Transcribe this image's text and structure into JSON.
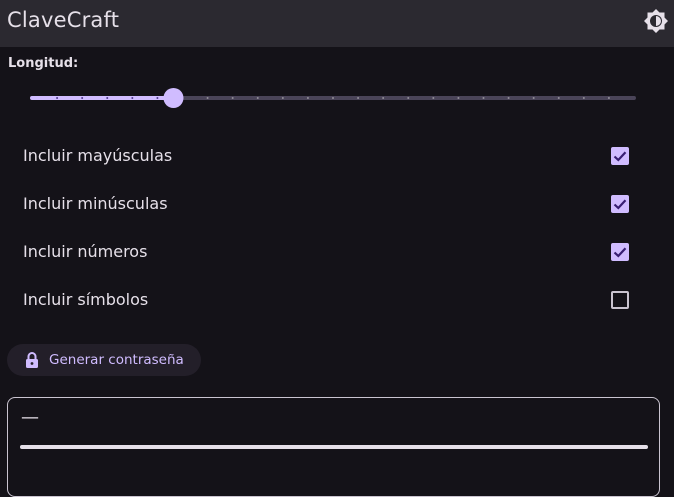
{
  "app_bar": {
    "title": "ClaveCraft",
    "theme_toggle_icon": "brightness-icon"
  },
  "length": {
    "label": "Longitud:",
    "slider_fraction": 0.235,
    "steps": 24
  },
  "options": [
    {
      "label": "Incluir mayúsculas",
      "checked": true
    },
    {
      "label": "Incluir minúsculas",
      "checked": true
    },
    {
      "label": "Incluir números",
      "checked": true
    },
    {
      "label": "Incluir símbolos",
      "checked": false
    }
  ],
  "generate_button": {
    "label": "Generar contraseña",
    "icon": "lock-icon"
  },
  "output": {
    "value": "—"
  },
  "colors": {
    "accent": "#d0bcff",
    "background": "#141218",
    "app_bar": "#2b2930",
    "track_inactive": "#4a4458"
  }
}
